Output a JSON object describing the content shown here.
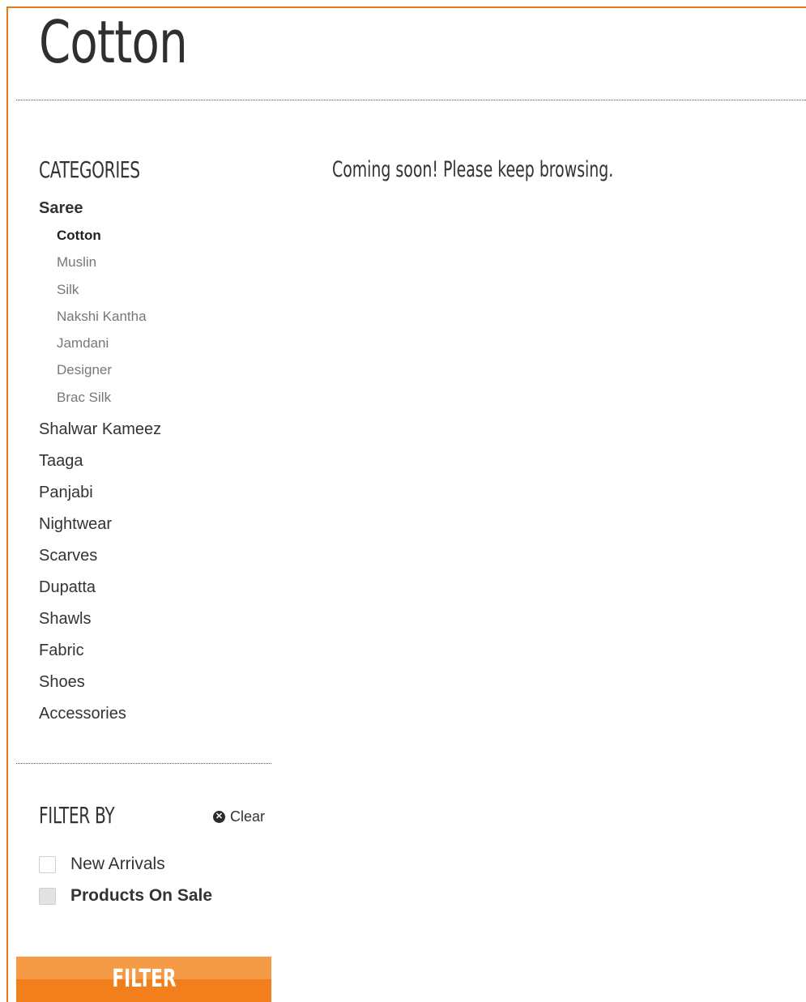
{
  "page": {
    "title": "Cotton",
    "message": "Coming soon! Please keep browsing."
  },
  "categories": {
    "heading": "CATEGORIES",
    "parent": {
      "label": "Saree",
      "children": [
        "Cotton",
        "Muslin",
        "Silk",
        "Nakshi Kantha",
        "Jamdani",
        "Designer",
        "Brac Silk"
      ],
      "active_child": "Cotton"
    },
    "items": [
      "Shalwar Kameez",
      "Taaga",
      "Panjabi",
      "Nightwear",
      "Scarves",
      "Dupatta",
      "Shawls",
      "Fabric",
      "Shoes",
      "Accessories"
    ]
  },
  "filter": {
    "heading": "FILTER BY",
    "clear_label": "Clear",
    "clear_icon": "close-circle-icon",
    "options": [
      {
        "label": "New Arrivals",
        "checked": false
      },
      {
        "label": "Products On Sale",
        "checked": false
      }
    ],
    "button_label": "FILTER"
  },
  "colors": {
    "accent": "#f07f1c",
    "accent_light": "#f59b45",
    "frame_border": "#e27a17",
    "text": "#333333",
    "muted_text": "#777777"
  }
}
